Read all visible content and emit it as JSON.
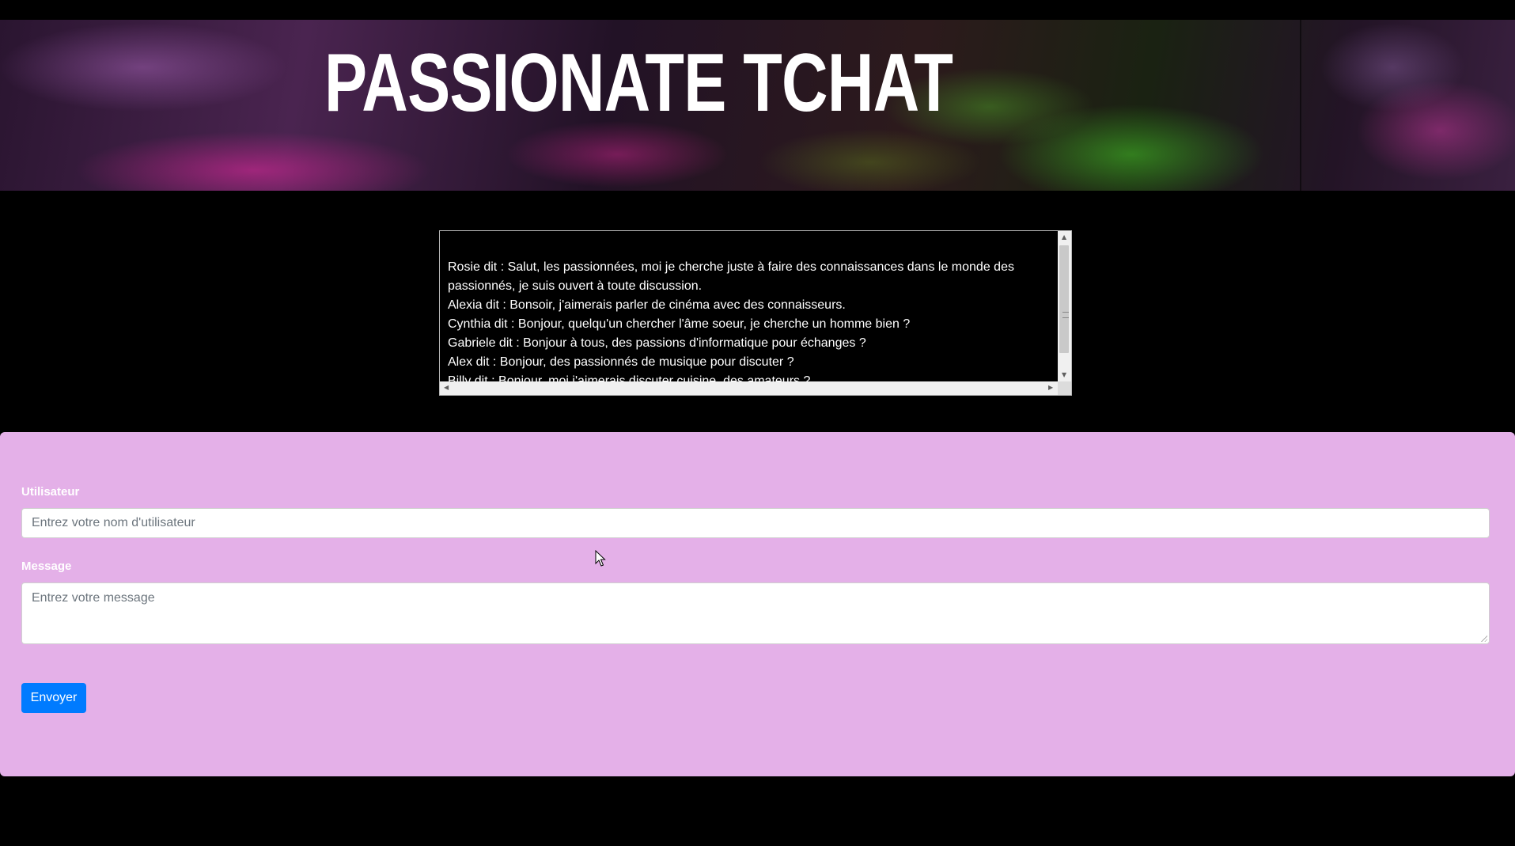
{
  "header": {
    "title": "PASSIONATE TCHAT"
  },
  "chat": {
    "messages": [
      "Rosie dit : Salut, les passionnées, moi je cherche juste à faire des connaissances dans le monde des passionnés, je suis ouvert à toute discussion.",
      "Alexia dit : Bonsoir, j'aimerais parler de cinéma avec des connaisseurs.",
      "Cynthia dit : Bonjour, quelqu'un chercher l'âme soeur, je cherche un homme bien ?",
      "Gabriele dit : Bonjour à tous, des passions d'informatique pour échanges ?",
      "Alex dit : Bonjour, des passionnés de musique pour discuter ?",
      "Billy dit : Bonjour, moi j'aimerais discuter cuisine, des amateurs ?"
    ]
  },
  "form": {
    "user_label": "Utilisateur",
    "user_placeholder": "Entrez votre nom d'utilisateur",
    "message_label": "Message",
    "message_placeholder": "Entrez votre message",
    "send_label": "Envoyer"
  },
  "colors": {
    "panel": "#e4b0e8",
    "button": "#007bff"
  }
}
